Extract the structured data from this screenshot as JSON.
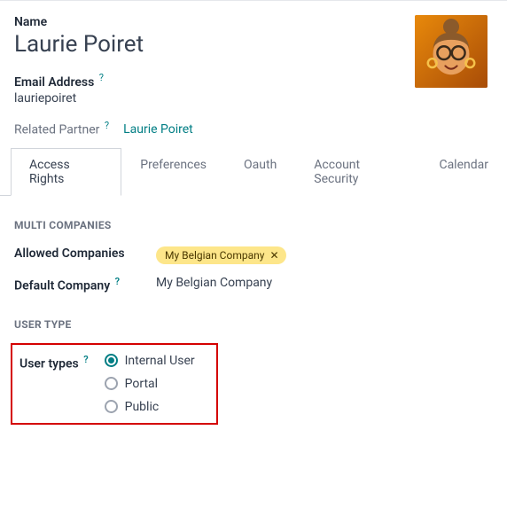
{
  "name_label": "Name",
  "name_value": "Laurie Poiret",
  "email_label": "Email Address",
  "email_value": "lauriepoiret",
  "related_partner_label": "Related Partner",
  "related_partner_value": "Laurie Poiret",
  "help": "?",
  "tabs": {
    "access_rights": "Access Rights",
    "preferences": "Preferences",
    "oauth": "Oauth",
    "account_security": "Account Security",
    "calendar": "Calendar"
  },
  "multi_companies_header": "MULTI COMPANIES",
  "allowed_companies_label": "Allowed Companies",
  "allowed_company_tag": "My Belgian Company",
  "default_company_label": "Default Company",
  "default_company_value": "My Belgian Company",
  "user_type_header": "USER TYPE",
  "user_types_label": "User types",
  "user_types_options": {
    "internal": "Internal User",
    "portal": "Portal",
    "public": "Public"
  }
}
